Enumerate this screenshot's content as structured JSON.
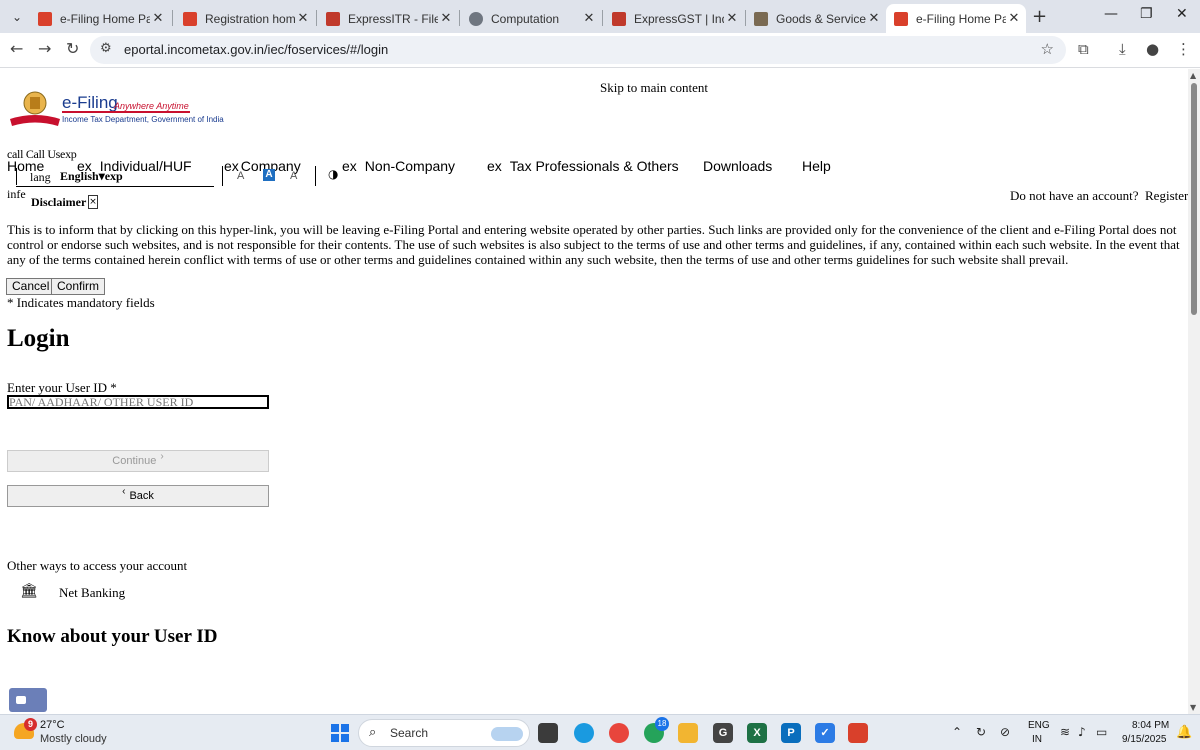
{
  "browser": {
    "menu_glyph": "⌄",
    "tabs": [
      {
        "title": "e-Filing Home Page, I",
        "fav_color": "#d9402b",
        "active": false
      },
      {
        "title": "Registration home, In",
        "fav_color": "#d9402b",
        "active": false
      },
      {
        "title": "ExpressITR - File Inco",
        "fav_color": "#c0392b",
        "active": false
      },
      {
        "title": "Computation",
        "fav_color": "#6f7680",
        "active": false
      },
      {
        "title": "ExpressGST | India's f",
        "fav_color": "#c0392b",
        "active": false
      },
      {
        "title": "Goods & Services Ta",
        "fav_color": "#7a6a52",
        "active": false
      },
      {
        "title": "e-Filing Home Page, I",
        "fav_color": "#d9402b",
        "active": true
      }
    ],
    "url": "eportal.incometax.gov.in/iec/foservices/#/login"
  },
  "page": {
    "skip_link": "Skip to main content",
    "logo": {
      "name": "e-Filing",
      "tagline": "Anywhere Anytime",
      "subtitle": "Income Tax Department, Government of India"
    },
    "call_bits": "call Call Usexp",
    "nav": {
      "home": "Home",
      "ex": "ex",
      "individual": "Individual/HUF",
      "company": "Company",
      "non_company": "Non-Company",
      "tax_pros": "Tax Professionals & Others",
      "downloads": "Downloads",
      "help": "Help"
    },
    "language": {
      "label": "lang",
      "value": "English",
      "caret": "▾",
      "suffix": "exp"
    },
    "font_size": {
      "smaller": "A",
      "normal": "A",
      "larger": "A"
    },
    "contrast_glyph": "◑",
    "infe_text": "infe",
    "disclaimer": {
      "title": "Disclaimer",
      "close": "×",
      "body": "This is to inform that by clicking on this hyper-link, you will be leaving e-Filing Portal and entering website operated by other parties. Such links are provided only for the convenience of the client and e-Filing Portal does not control or endorse such websites, and is not responsible for their contents. The use of such websites is also subject to the terms of use and other terms and guidelines, if any, contained within each such website. In the event that any of the terms contained herein conflict with terms of use or other terms and guidelines contained within any such website, then the terms of use and other terms guidelines for such website shall prevail.",
      "cancel": "Cancel",
      "confirm": "Confirm"
    },
    "account_prompt": "Do not have an account?",
    "register": "Register",
    "mandatory_note": "* Indicates mandatory fields",
    "login_title": "Login",
    "user_id_label": "Enter your User ID *",
    "user_id_placeholder": "PAN/ AADHAAR/ OTHER USER ID",
    "continue_label": "Continue",
    "back_label": "Back",
    "chevron_right": "›",
    "chevron_left": "‹",
    "other_ways": "Other ways to access your account",
    "net_banking": "Net Banking",
    "know_user_id": "Know about your User ID"
  },
  "taskbar": {
    "weather_badge": "9",
    "temperature": "27°C",
    "condition": "Mostly cloudy",
    "search_label": "Search",
    "whatsapp_badge": "18",
    "lang_line1": "ENG",
    "lang_line2": "IN",
    "time": "8:04 PM",
    "date": "9/15/2025"
  }
}
